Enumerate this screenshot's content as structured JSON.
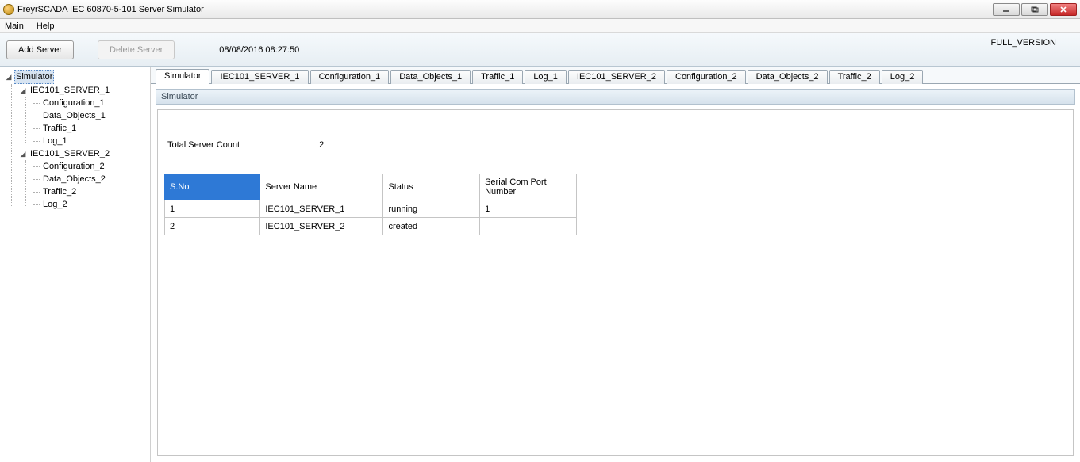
{
  "window": {
    "title": "FreyrSCADA IEC 60870-5-101 Server Simulator"
  },
  "menu": {
    "main": "Main",
    "help": "Help"
  },
  "toolbar": {
    "add_server": "Add Server",
    "delete_server": "Delete Server",
    "timestamp": "08/08/2016 08:27:50",
    "version": "FULL_VERSION"
  },
  "tree": {
    "root": "Simulator",
    "servers": [
      {
        "name": "IEC101_SERVER_1",
        "children": [
          "Configuration_1",
          "Data_Objects_1",
          "Traffic_1",
          "Log_1"
        ]
      },
      {
        "name": "IEC101_SERVER_2",
        "children": [
          "Configuration_2",
          "Data_Objects_2",
          "Traffic_2",
          "Log_2"
        ]
      }
    ]
  },
  "tabs": [
    "Simulator",
    "IEC101_SERVER_1",
    "Configuration_1",
    "Data_Objects_1",
    "Traffic_1",
    "Log_1",
    "IEC101_SERVER_2",
    "Configuration_2",
    "Data_Objects_2",
    "Traffic_2",
    "Log_2"
  ],
  "panel": {
    "caption": "Simulator",
    "count_label": "Total Server Count",
    "count_value": "2",
    "columns": {
      "sno": "S.No",
      "name": "Server Name",
      "status": "Status",
      "port": "Serial Com Port Number"
    },
    "rows": [
      {
        "sno": "1",
        "name": "IEC101_SERVER_1",
        "status": "running",
        "port": "1"
      },
      {
        "sno": "2",
        "name": "IEC101_SERVER_2",
        "status": "created",
        "port": ""
      }
    ]
  }
}
